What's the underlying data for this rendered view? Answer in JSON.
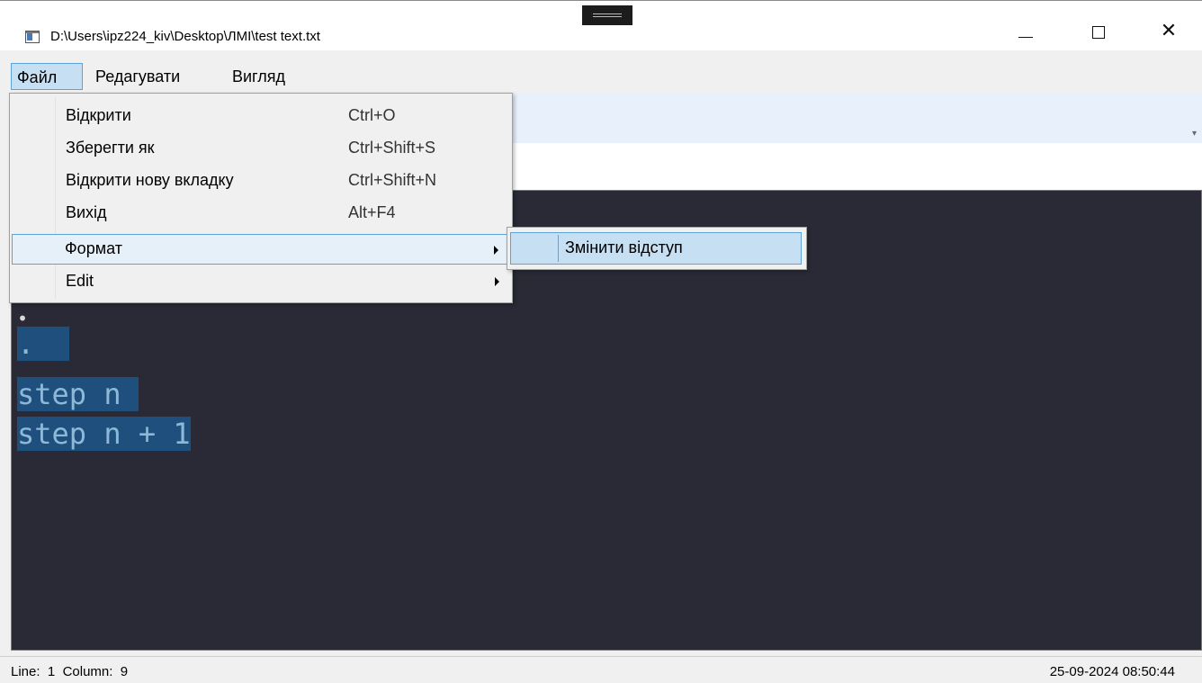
{
  "window": {
    "title": "D:\\Users\\ipz224_kiv\\Desktop\\ЛМІ\\test text.txt",
    "minimize_glyph": "minimize-icon",
    "maximize_glyph": "maximize-icon",
    "close_glyph": "✕"
  },
  "menubar": {
    "items": [
      {
        "label": "Файл"
      },
      {
        "label": "Редагувати"
      },
      {
        "label": "Вигляд"
      }
    ]
  },
  "file_menu": {
    "items": [
      {
        "label": "Відкрити",
        "shortcut": "Ctrl+O"
      },
      {
        "label": "Зберегти як",
        "shortcut": "Ctrl+Shift+S"
      },
      {
        "label": "Відкрити нову вкладку",
        "shortcut": "Ctrl+Shift+N"
      },
      {
        "label": "Вихід",
        "shortcut": "Alt+F4"
      },
      {
        "label": "Формат",
        "shortcut": ""
      },
      {
        "label": "Edit",
        "shortcut": ""
      }
    ]
  },
  "format_submenu": {
    "items": [
      {
        "label": "Змінити відступ"
      }
    ]
  },
  "editor": {
    "lines": [
      "•",
      ".",
      "step n ",
      "step n + 1"
    ]
  },
  "status": {
    "line_label": "Line:",
    "line_value": "1",
    "column_label": "Column:",
    "column_value": "9",
    "datetime": "25-09-2024 08:50:44"
  },
  "toolbar": {
    "overflow_icon": "toolbar-overflow-icon"
  },
  "colors": {
    "editor_bg": "#292a35",
    "selection": "#1f4f7c",
    "menu_highlight": "#c6dff2",
    "menu_border": "#5ea3d6"
  }
}
